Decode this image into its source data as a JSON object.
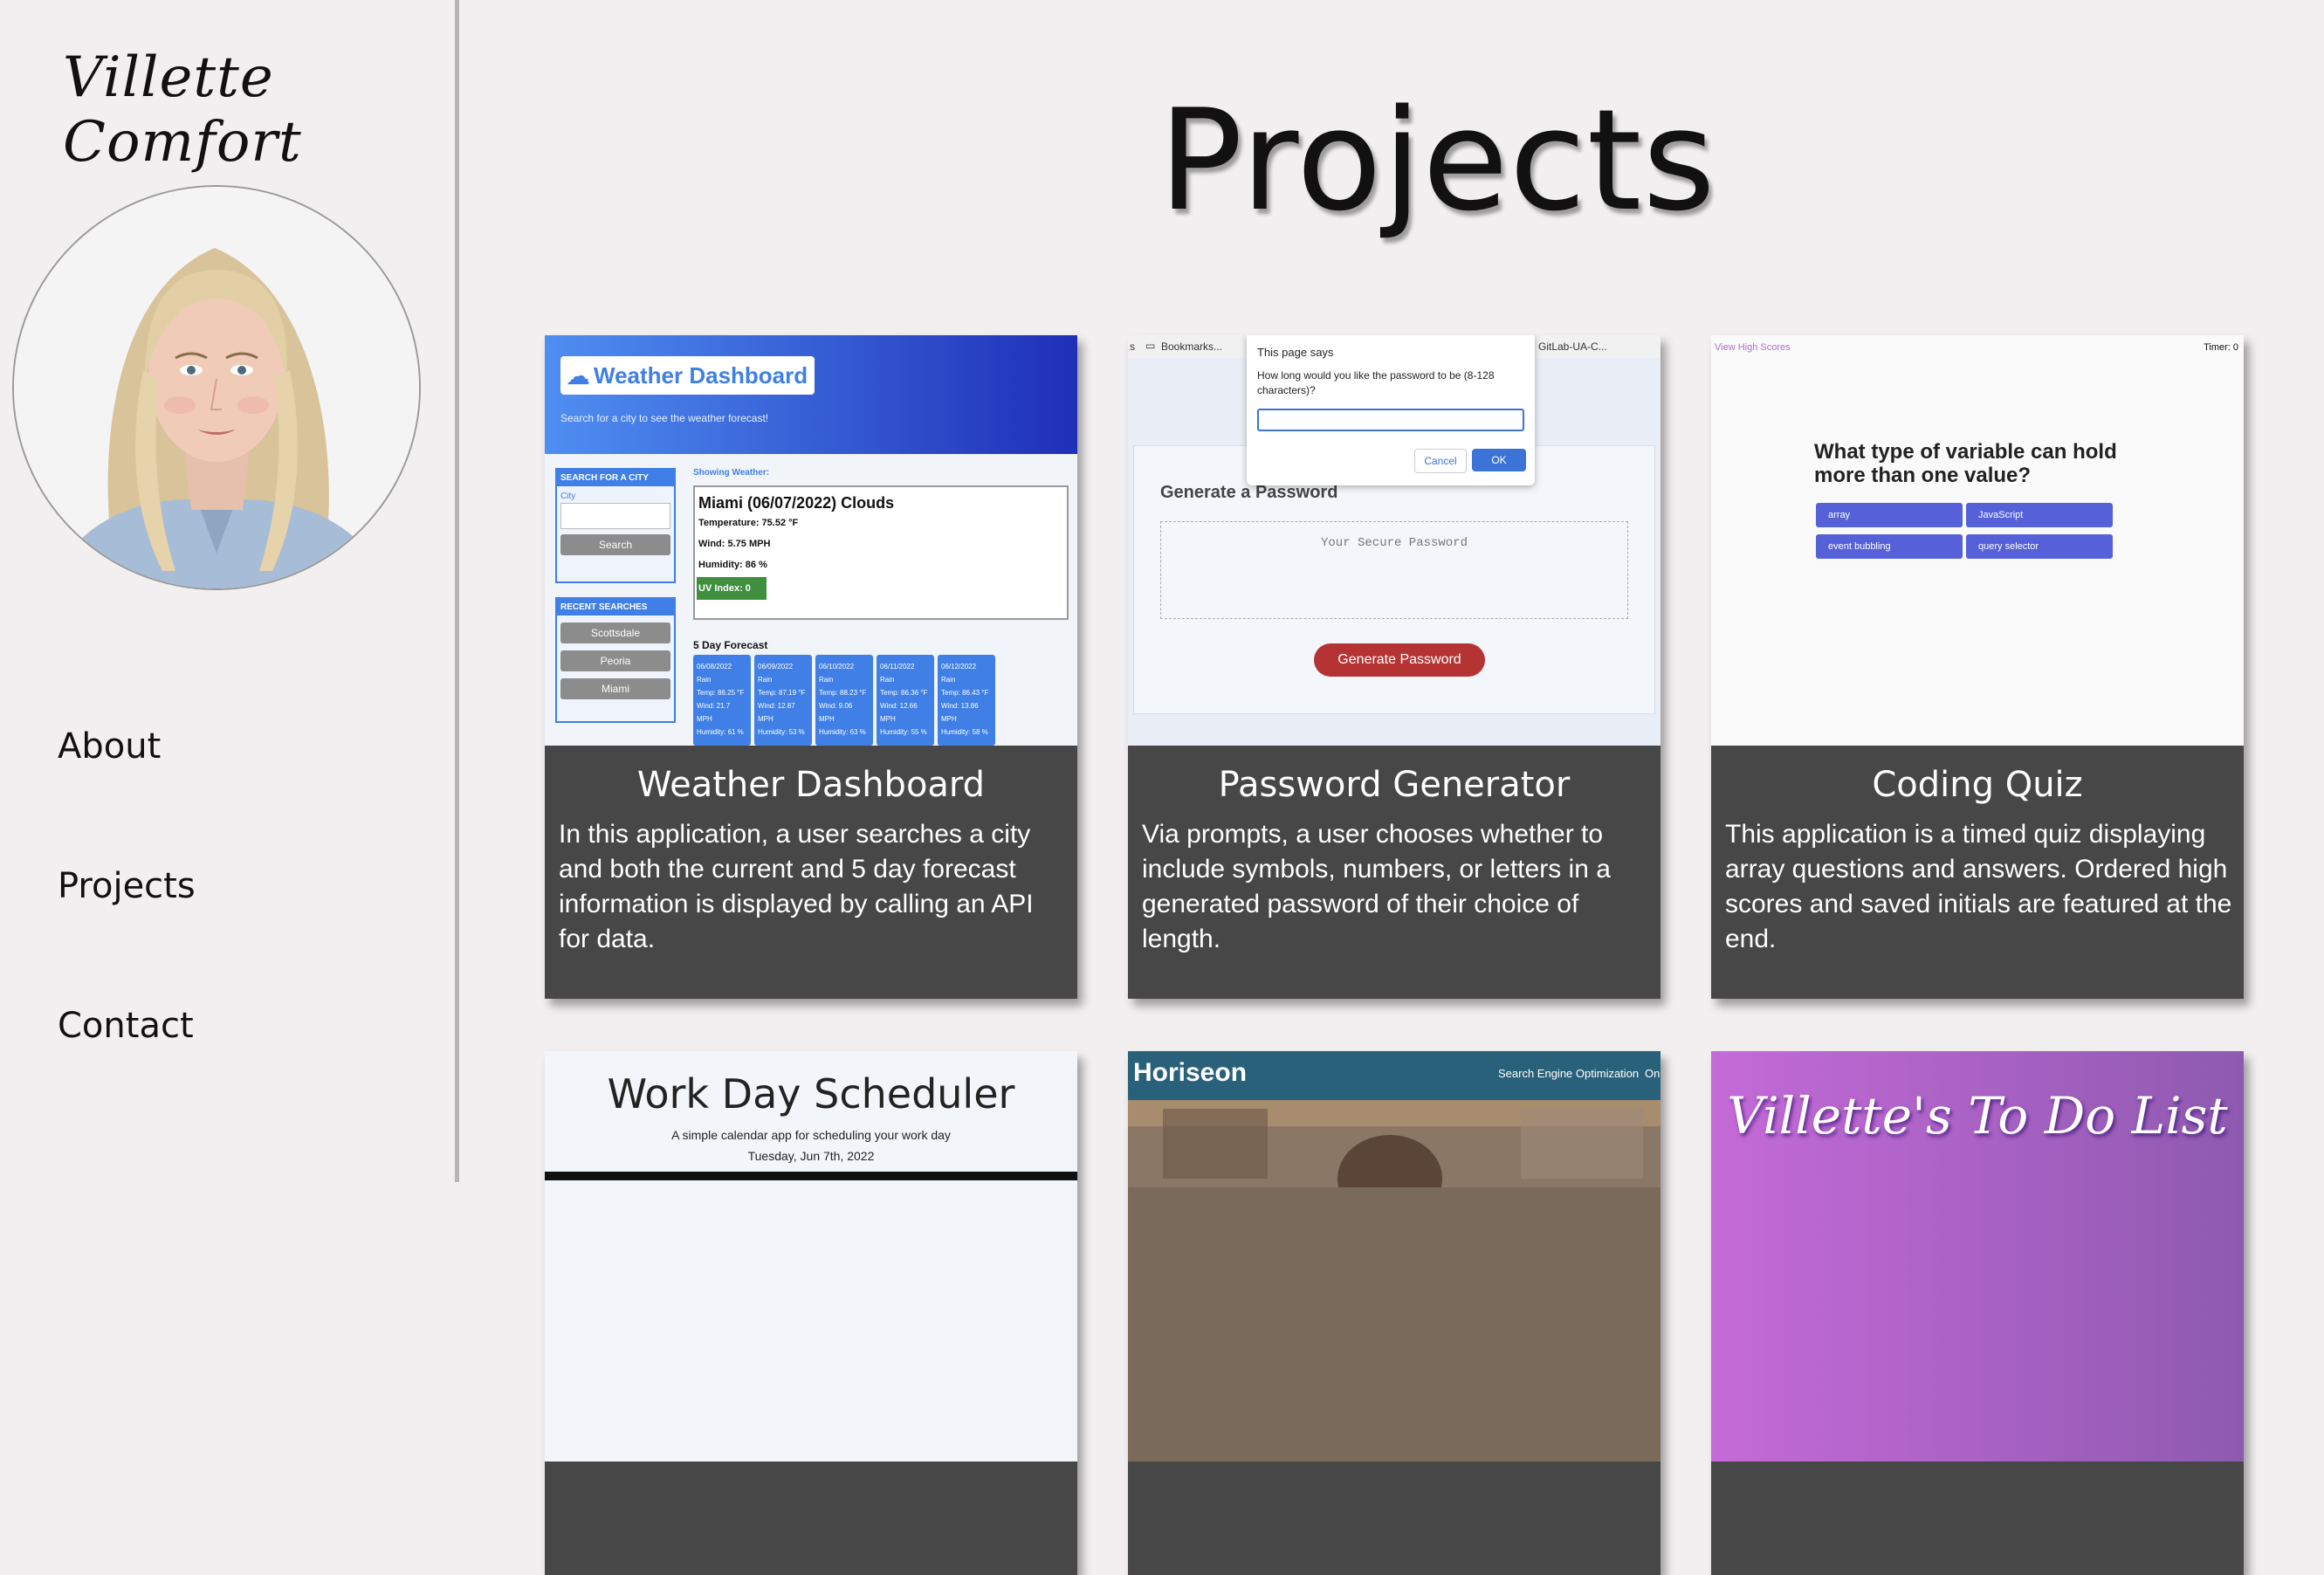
{
  "sidebar": {
    "brand": "Villette Comfort",
    "nav": [
      {
        "label": "About"
      },
      {
        "label": "Projects"
      },
      {
        "label": "Contact"
      }
    ]
  },
  "main": {
    "title": "Projects",
    "cards": [
      {
        "title": "Weather Dashboard",
        "description": "In this application, a user searches a city and both the current and 5 day forecast information is displayed by calling an API for data.",
        "thumb": {
          "header": "Weather Dashboard",
          "subheader": "Search for a city to see the weather forecast!",
          "search_heading": "SEARCH FOR A CITY",
          "city_label": "City",
          "search_button": "Search",
          "recent_heading": "RECENT SEARCHES",
          "recent": [
            "Scottsdale",
            "Peoria",
            "Miami"
          ],
          "showing": "Showing Weather:",
          "current_title": "Miami (06/07/2022) Clouds",
          "temp": "Temperature: 75.52 °F",
          "wind": "Wind: 5.75 MPH",
          "humidity": "Humidity: 86 %",
          "uv": "UV Index: 0",
          "forecast_heading": "5 Day Forecast",
          "forecast": [
            {
              "date": "06/08/2022",
              "cond": "Rain",
              "temp": "Temp: 86.25 °F",
              "wind": "Wind: 21.7 MPH",
              "hum": "Humidity: 61 %"
            },
            {
              "date": "06/09/2022",
              "cond": "Rain",
              "temp": "Temp: 87.19 °F",
              "wind": "Wind: 12.87 MPH",
              "hum": "Humidity: 53 %"
            },
            {
              "date": "06/10/2022",
              "cond": "Rain",
              "temp": "Temp: 88.23 °F",
              "wind": "Wind: 9.06 MPH",
              "hum": "Humidity: 63 %"
            },
            {
              "date": "06/11/2022",
              "cond": "Rain",
              "temp": "Temp: 86.36 °F",
              "wind": "Wind: 12.66 MPH",
              "hum": "Humidity: 55 %"
            },
            {
              "date": "06/12/2022",
              "cond": "Rain",
              "temp": "Temp: 86.43 °F",
              "wind": "Wind: 13.86 MPH",
              "hum": "Humidity: 58 %"
            }
          ]
        }
      },
      {
        "title": "Password Generator",
        "description": "Via prompts, a user chooses whether to include symbols, numbers, or letters in a generated password of their choice of length.",
        "thumb": {
          "bar_left": "s",
          "bar_bookmarks": "Bookmarks...",
          "bar_right": "GitLab-UA-C...",
          "dialog_title": "This page says",
          "dialog_text": "How long would you like the password to be (8-128 characters)?",
          "cancel": "Cancel",
          "ok": "OK",
          "heading": "Generate a Password",
          "placeholder": "Your Secure Password",
          "button": "Generate Password"
        }
      },
      {
        "title": "Coding Quiz",
        "description": "This application is a timed quiz displaying array questions and answers. Ordered high scores and saved initials are featured at the end.",
        "thumb": {
          "high_scores": "View High Scores",
          "timer": "Timer: 0",
          "question": "What type of variable can hold more than one value?",
          "answers": [
            "array",
            "JavaScript",
            "event bubbling",
            "query selector"
          ]
        }
      },
      {
        "title": "",
        "thumb": {
          "header": "Work Day Scheduler",
          "sub": "A simple calendar app for scheduling your work day",
          "date": "Tuesday, Jun 7th, 2022"
        }
      },
      {
        "title": "",
        "thumb": {
          "logo": "Horiseon",
          "nav1": "Search Engine Optimization",
          "nav2": "On"
        }
      },
      {
        "title": "",
        "thumb": {
          "header": "Villette's To Do List"
        }
      }
    ]
  },
  "colors": {
    "card_bg": "#474747",
    "page_bg": "#f2eff0",
    "weather_blue": "#3f7fe6",
    "generate_red": "#b53333",
    "quiz_purple": "#5660d9"
  }
}
